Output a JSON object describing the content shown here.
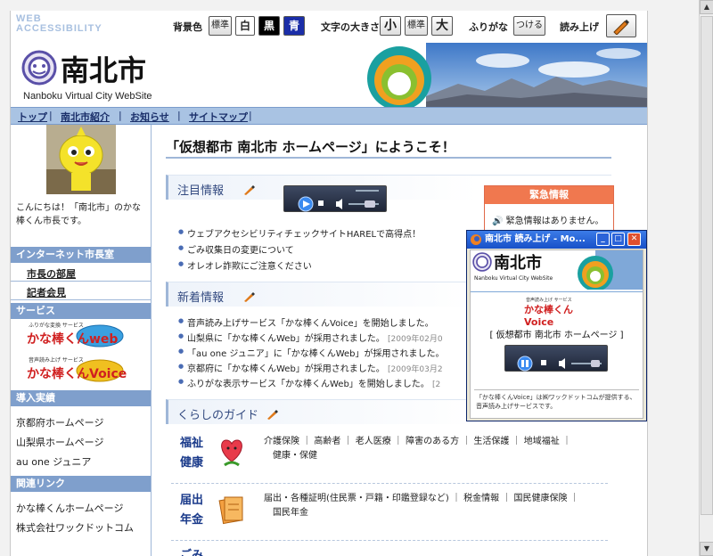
{
  "access_bar": {
    "logo_line1": "WEB",
    "logo_line2": "ACCESSIBILITY",
    "bg_color_label": "背景色",
    "bg_standard": "標準",
    "bg_white": "白",
    "bg_black": "黒",
    "bg_blue": "青",
    "text_size_label": "文字の大きさ",
    "size_small": "小",
    "size_standard": "標準",
    "size_large": "大",
    "furigana_label": "ふりがな",
    "furigana_button": "つける",
    "read_aloud_label": "読み上げ"
  },
  "header": {
    "site_name": "南北市",
    "site_sub": "Nanboku Virtual City WebSite"
  },
  "nav": {
    "items": [
      "トップ",
      "南北市紹介",
      "お知らせ",
      "サイトマップ"
    ]
  },
  "sidebar": {
    "greeting": "こんにちは！「南北市」のかな棒くん市長です。",
    "internet_mayor": "インターネット市長室",
    "mayor_room": "市長の部屋",
    "press": "記者会見",
    "services": "サービス",
    "banner_web_small": "ふりがな変換 サービス",
    "banner_web": "かな棒くんweb",
    "banner_voice_small": "音声読み上げ サービス",
    "banner_voice": "かな棒くんVoice",
    "achievements": "導入実績",
    "achievement_links": [
      "京都府ホームページ",
      "山梨県ホームページ",
      "au one ジュニア"
    ],
    "related": "関連リンク",
    "related_links": [
      "かな棒くんホームページ",
      "株式会社ワックドットコム"
    ]
  },
  "main": {
    "welcome": "「仮想都市 南北市 ホームページ」にようこそ！",
    "featured_title": "注目情報",
    "featured_items": [
      "ウェブアクセシビリティチェックサイトHARELで高得点！",
      "ごみ収集日の変更について",
      "オレオレ詐欺にご注意ください"
    ],
    "emergency_title": "緊急情報",
    "emergency_text": "緊急情報はありません。",
    "news_title": "新着情報",
    "news_items": [
      {
        "text": "音声読み上げサービス「かな棒くんVoice」を開始しました。",
        "date": ""
      },
      {
        "text": "山梨県に「かな棒くんWeb」が採用されました。",
        "date": "[2009年02月0"
      },
      {
        "text": "「au one ジュニア」に「かな棒くんWeb」が採用されました。",
        "date": ""
      },
      {
        "text": "京都府に「かな棒くんWeb」が採用されました。",
        "date": "[2009年03月2"
      },
      {
        "text": "ふりがな表示サービス「かな棒くんWeb」を開始しました。",
        "date": "[2"
      }
    ],
    "guide_title": "くらしのガイド",
    "guide_rows": [
      {
        "title1": "福祉",
        "title2": "健康",
        "line1": "介護保険 ｜ 高齢者 ｜ 老人医療 ｜ 障害のある方 ｜ 生活保護 ｜ 地域福祉 ｜",
        "line2": "健康・保健"
      },
      {
        "title1": "届出",
        "title2": "年金",
        "line1": "届出・各種証明(住民票・戸籍・印鑑登録など) ｜ 税金情報 ｜ 国民健康保険 ｜",
        "line2": "国民年金"
      },
      {
        "title1": "ごみ",
        "title2": "",
        "line1": "",
        "line2": ""
      }
    ]
  },
  "popup": {
    "title": "南北市 読み上げ - Mo...",
    "site_name": "南北市",
    "site_sub": "Nanboku Virtual City WebSite",
    "banner_small": "音声読み上げ サービス",
    "banner": "かな棒くんVoice",
    "page_title": "[ 仮想都市 南北市 ホームページ ]",
    "footer": "「かな棒くんVoice」は㈱ワックドットコムが提供する、音声読み上げサービスです。"
  },
  "colors": {
    "accent": "#7f9fcc",
    "nav": "#a9c3e3",
    "emergency": "#f0784f",
    "guide_title": "#1a3a8a"
  }
}
